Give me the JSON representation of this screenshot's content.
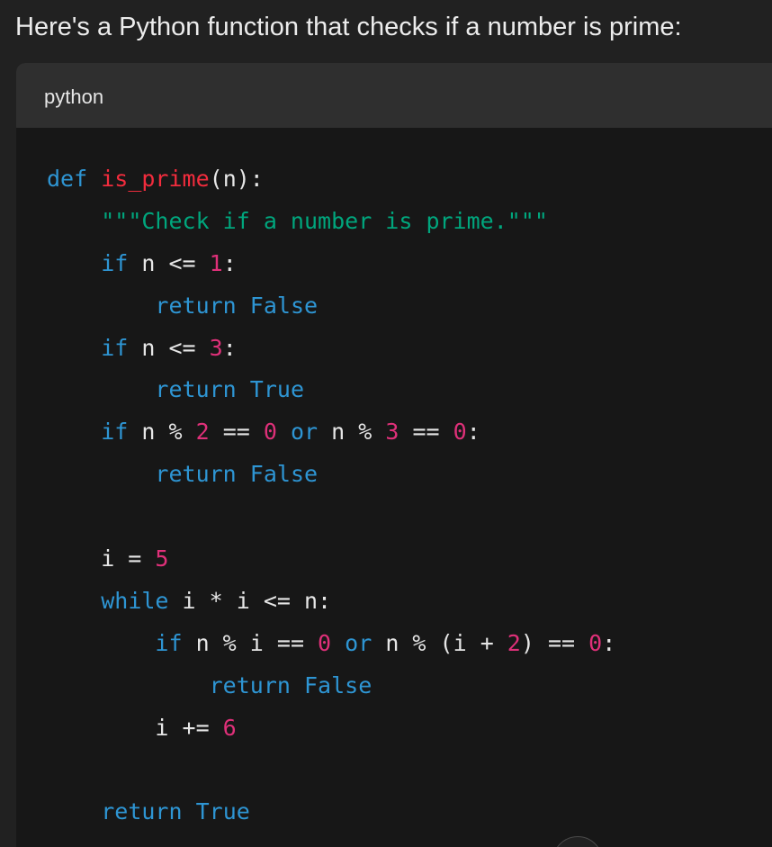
{
  "message": {
    "intro_text": "Here's a Python function that checks if a number is prime:"
  },
  "code_block": {
    "language": "python",
    "lines": [
      [
        {
          "t": "def",
          "k": "keyword"
        },
        {
          "t": " ",
          "k": "plain"
        },
        {
          "t": "is_prime",
          "k": "func"
        },
        {
          "t": "(n):",
          "k": "plain"
        }
      ],
      [
        {
          "t": "    ",
          "k": "plain"
        },
        {
          "t": "\"\"\"Check if a number is prime.\"\"\"",
          "k": "string"
        }
      ],
      [
        {
          "t": "    ",
          "k": "plain"
        },
        {
          "t": "if",
          "k": "keyword"
        },
        {
          "t": " n <= ",
          "k": "plain"
        },
        {
          "t": "1",
          "k": "number"
        },
        {
          "t": ":",
          "k": "plain"
        }
      ],
      [
        {
          "t": "        ",
          "k": "plain"
        },
        {
          "t": "return",
          "k": "keyword"
        },
        {
          "t": " ",
          "k": "plain"
        },
        {
          "t": "False",
          "k": "keyword"
        }
      ],
      [
        {
          "t": "    ",
          "k": "plain"
        },
        {
          "t": "if",
          "k": "keyword"
        },
        {
          "t": " n <= ",
          "k": "plain"
        },
        {
          "t": "3",
          "k": "number"
        },
        {
          "t": ":",
          "k": "plain"
        }
      ],
      [
        {
          "t": "        ",
          "k": "plain"
        },
        {
          "t": "return",
          "k": "keyword"
        },
        {
          "t": " ",
          "k": "plain"
        },
        {
          "t": "True",
          "k": "keyword"
        }
      ],
      [
        {
          "t": "    ",
          "k": "plain"
        },
        {
          "t": "if",
          "k": "keyword"
        },
        {
          "t": " n % ",
          "k": "plain"
        },
        {
          "t": "2",
          "k": "number"
        },
        {
          "t": " == ",
          "k": "plain"
        },
        {
          "t": "0",
          "k": "number"
        },
        {
          "t": " ",
          "k": "plain"
        },
        {
          "t": "or",
          "k": "keyword"
        },
        {
          "t": " n % ",
          "k": "plain"
        },
        {
          "t": "3",
          "k": "number"
        },
        {
          "t": " == ",
          "k": "plain"
        },
        {
          "t": "0",
          "k": "number"
        },
        {
          "t": ":",
          "k": "plain"
        }
      ],
      [
        {
          "t": "        ",
          "k": "plain"
        },
        {
          "t": "return",
          "k": "keyword"
        },
        {
          "t": " ",
          "k": "plain"
        },
        {
          "t": "False",
          "k": "keyword"
        }
      ],
      [],
      [
        {
          "t": "    i = ",
          "k": "plain"
        },
        {
          "t": "5",
          "k": "number"
        }
      ],
      [
        {
          "t": "    ",
          "k": "plain"
        },
        {
          "t": "while",
          "k": "keyword"
        },
        {
          "t": " i * i <= n:",
          "k": "plain"
        }
      ],
      [
        {
          "t": "        ",
          "k": "plain"
        },
        {
          "t": "if",
          "k": "keyword"
        },
        {
          "t": " n % i == ",
          "k": "plain"
        },
        {
          "t": "0",
          "k": "number"
        },
        {
          "t": " ",
          "k": "plain"
        },
        {
          "t": "or",
          "k": "keyword"
        },
        {
          "t": " n % (i + ",
          "k": "plain"
        },
        {
          "t": "2",
          "k": "number"
        },
        {
          "t": ") == ",
          "k": "plain"
        },
        {
          "t": "0",
          "k": "number"
        },
        {
          "t": ":",
          "k": "plain"
        }
      ],
      [
        {
          "t": "            ",
          "k": "plain"
        },
        {
          "t": "return",
          "k": "keyword"
        },
        {
          "t": " ",
          "k": "plain"
        },
        {
          "t": "False",
          "k": "keyword"
        }
      ],
      [
        {
          "t": "        i += ",
          "k": "plain"
        },
        {
          "t": "6",
          "k": "number"
        }
      ],
      [],
      [
        {
          "t": "    ",
          "k": "plain"
        },
        {
          "t": "return",
          "k": "keyword"
        },
        {
          "t": " ",
          "k": "plain"
        },
        {
          "t": "True",
          "k": "keyword"
        }
      ]
    ]
  },
  "colors": {
    "page_background": "#212121",
    "code_background": "#171717",
    "header_background": "#2f2f2f",
    "keyword": "#2e95d3",
    "function_name": "#f22c3d",
    "string": "#00a67d",
    "number": "#df3079",
    "plain_text": "#e6e6e6"
  }
}
